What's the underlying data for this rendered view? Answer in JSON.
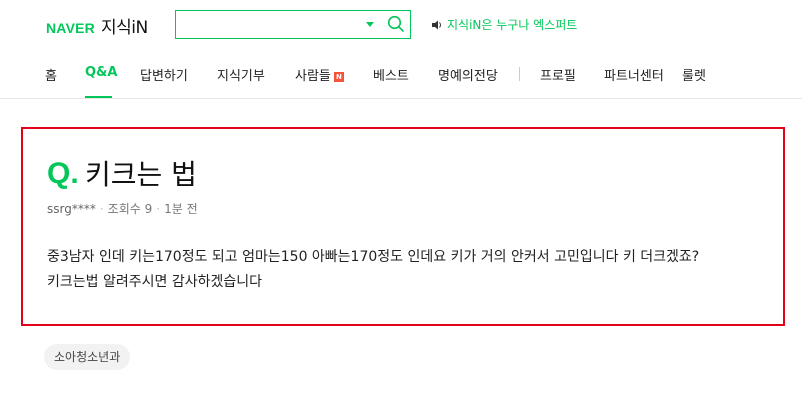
{
  "header": {
    "logo_naver": "NAVER",
    "logo_kin": "지식iN",
    "search": {
      "value": "",
      "placeholder": ""
    },
    "promo": "지식iN은 누구나 엑스퍼트",
    "accent_color": "#03c75a"
  },
  "nav": {
    "items": [
      {
        "label": "홈"
      },
      {
        "label": "Q&A",
        "active": true
      },
      {
        "label": "답변하기"
      },
      {
        "label": "지식기부"
      },
      {
        "label": "사람들",
        "badge": "N"
      },
      {
        "label": "베스트"
      },
      {
        "label": "명예의전당"
      },
      {
        "label": "프로필"
      },
      {
        "label": "파트너센터"
      },
      {
        "label": "룰렛"
      }
    ]
  },
  "question": {
    "marker": "Q.",
    "title": "키크는 법",
    "author": "ssrg****",
    "views": "조회수 9",
    "time": "1분 전",
    "body_line1": "중3남자 인데 키는170정도 되고 엄마는150 아빠는170정도 인데요 키가 거의 안커서 고민입니다 키 더크겠죠?",
    "body_line2": "키크는법 알려주시면 감사하겠습니다"
  },
  "tags": [
    "소아청소년과"
  ]
}
